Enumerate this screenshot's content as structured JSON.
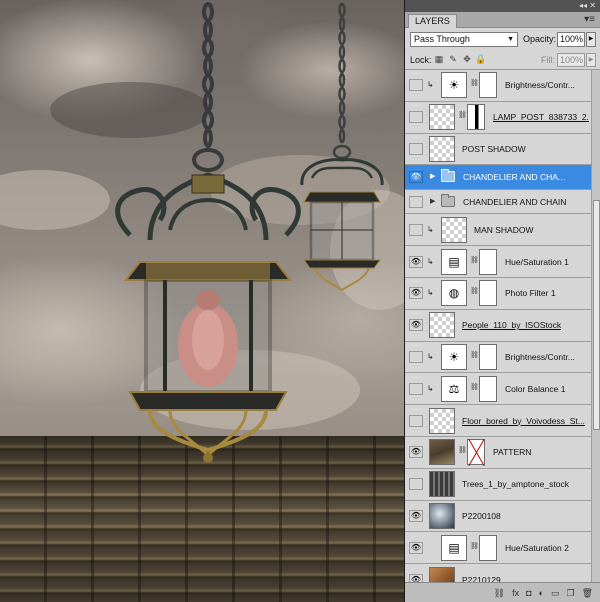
{
  "panel": {
    "tab_label": "LAYERS",
    "menu_icon": "panel-menu-icon",
    "blend_mode": "Pass Through",
    "opacity_label": "Opacity:",
    "opacity_value": "100%",
    "lock_label": "Lock:",
    "fill_label": "Fill:",
    "fill_value": "100%"
  },
  "layers": [
    {
      "name": "Brightness/Contr...",
      "visible": false,
      "kind": "adjustment",
      "icon": "brightness-icon",
      "clipped": true
    },
    {
      "name": "LAMP_POST_838733_2...",
      "visible": false,
      "kind": "smart",
      "underline": true,
      "mask": "dark"
    },
    {
      "name": "POST SHADOW",
      "visible": false,
      "kind": "pixel"
    },
    {
      "name": "CHANDELIER AND CHA...",
      "visible": true,
      "kind": "group",
      "selected": true
    },
    {
      "name": "CHANDELIER AND CHAIN",
      "visible": false,
      "kind": "group"
    },
    {
      "name": "MAN SHADOW",
      "visible": false,
      "kind": "pixel",
      "clipped": true
    },
    {
      "name": "Hue/Saturation 1",
      "visible": true,
      "kind": "adjustment",
      "icon": "hue-sat-icon",
      "clipped": true
    },
    {
      "name": "Photo Filter 1",
      "visible": true,
      "kind": "adjustment",
      "icon": "photo-filter-icon",
      "clipped": true
    },
    {
      "name": "People_110_by_ISOStock",
      "visible": true,
      "kind": "pixel",
      "underline": true
    },
    {
      "name": "Brightness/Contr...",
      "visible": false,
      "kind": "adjustment",
      "icon": "brightness-icon",
      "clipped": true
    },
    {
      "name": "Color Balance 1",
      "visible": false,
      "kind": "adjustment",
      "icon": "color-balance-icon",
      "clipped": true
    },
    {
      "name": "Floor_bored_by_Voivodess_St...",
      "visible": false,
      "kind": "pixel",
      "underline": true
    },
    {
      "name": "PATTERN",
      "visible": true,
      "kind": "photo-a",
      "mask": "red-x"
    },
    {
      "name": "Trees_1_by_amptone_stock",
      "visible": false,
      "kind": "dark"
    },
    {
      "name": "P2200108",
      "visible": true,
      "kind": "photo-b"
    },
    {
      "name": "Hue/Saturation 2",
      "visible": true,
      "kind": "adjustment",
      "icon": "hue-sat-icon"
    },
    {
      "name": "P2210129",
      "visible": true,
      "kind": "photo-c"
    }
  ],
  "bottom_icons": [
    "link-layers-icon",
    "fx-icon",
    "add-mask-icon",
    "new-adjustment-icon",
    "new-group-icon",
    "new-layer-icon",
    "delete-icon"
  ],
  "bottom_glyphs": [
    "⛓",
    "fx",
    "◘",
    "◐",
    "▭",
    "❐",
    "🗑"
  ]
}
